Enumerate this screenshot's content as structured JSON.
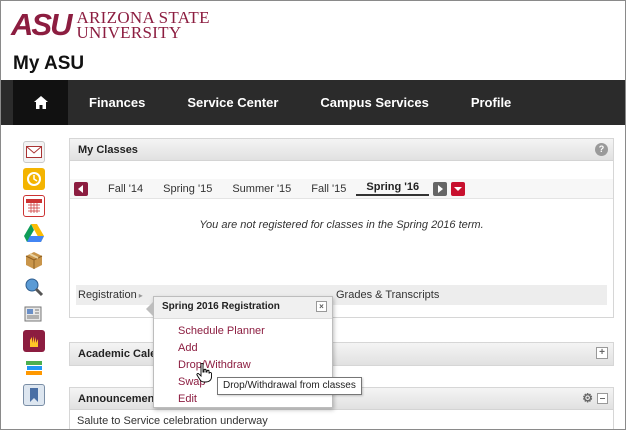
{
  "header": {
    "logo_mark": "ASU",
    "logo_line1": "ARIZONA STATE",
    "logo_line2": "UNIVERSITY",
    "site_title": "My ASU"
  },
  "nav": {
    "home_icon": "home-icon",
    "items": [
      "Finances",
      "Service Center",
      "Campus Services",
      "Profile"
    ]
  },
  "sidebar_icons": [
    "mail-icon",
    "outlook-icon",
    "calendar-icon",
    "google-drive-icon",
    "package-icon",
    "search-globe-icon",
    "news-icon",
    "asu-icon",
    "books-icon",
    "bookmark-icon"
  ],
  "my_classes": {
    "title": "My Classes",
    "help": "?",
    "terms": [
      "Fall '14",
      "Spring '15",
      "Summer '15",
      "Fall '15",
      "Spring '16"
    ],
    "active_term": "Spring '16",
    "message": "You are not registered for classes in the Spring 2016 term.",
    "registration_label": "Registration",
    "grades_label": "Grades & Transcripts"
  },
  "registration_popup": {
    "title": "Spring 2016 Registration",
    "close": "×",
    "items": [
      "Schedule Planner",
      "Add",
      "Drop/Withdraw",
      "Swap",
      "Edit"
    ],
    "tooltip": "Drop/Withdrawal from classes"
  },
  "academic_calendar": {
    "title": "Academic Calen"
  },
  "announcements": {
    "title": "Announcements",
    "first_item": "Salute to Service celebration underway"
  },
  "colors": {
    "maroon": "#8c1d40",
    "gold": "#ffc627",
    "nav_bg": "#2b2b2b"
  }
}
